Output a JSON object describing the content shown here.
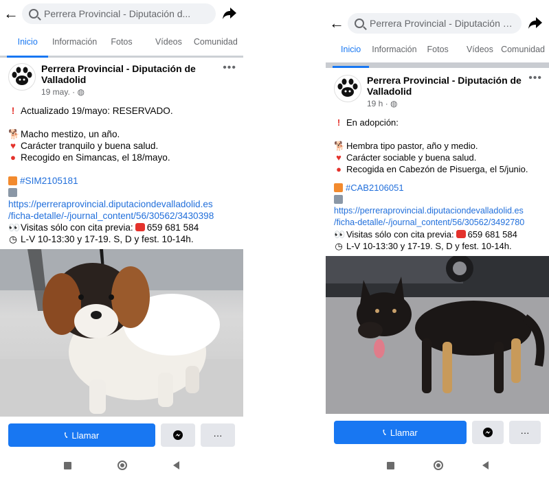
{
  "left": {
    "search_text": "Perrera Provincial - Diputación d...",
    "tabs": [
      {
        "label": "Inicio"
      },
      {
        "label": "Información"
      },
      {
        "label": "Fotos"
      },
      {
        "label": "Vídeos"
      },
      {
        "label": "Comunidad"
      }
    ],
    "post": {
      "title": "Perrera Provincial - Diputación de Valladolid",
      "time": "19 may. · ",
      "line1": "Actualizado 19/mayo: RESERVADO.",
      "line2": "Macho mestizo, un año.",
      "line3": "Carácter tranquilo y buena salud.",
      "line4": "Recogido en Simancas, el 18/mayo.",
      "hashtag": "#SIM2105181",
      "link1": "https://perreraprovincial.diputaciondevalladolid.es",
      "link2": "/ficha-detalle/-/journal_content/56/30562/3430398",
      "visits": "Visitas sólo con cita previa:",
      "phone": "659 681 584",
      "hours": "L-V 10-13:30 y 17-19. S, D y fest. 10-14h."
    },
    "call_label": "Llamar",
    "more_label": "···"
  },
  "right": {
    "search_text": "Perrera Provincial - Diputación d...",
    "tabs": [
      {
        "label": "Inicio"
      },
      {
        "label": "Información"
      },
      {
        "label": "Fotos"
      },
      {
        "label": "Vídeos"
      },
      {
        "label": "Comunidad"
      }
    ],
    "post": {
      "title": "Perrera Provincial - Diputación de Valladolid",
      "time": "19 h · ",
      "line1": "En adopción:",
      "line2": "Hembra tipo pastor, año y medio.",
      "line3": "Carácter sociable y buena salud.",
      "line4": "Recogida en Cabezón de Pisuerga, el 5/junio.",
      "hashtag": "#CAB2106051",
      "link1": "https://perreraprovincial.diputaciondevalladolid.es",
      "link2": "/ficha-detalle/-/journal_content/56/30562/3492780",
      "visits": "Visitas sólo con cita previa:",
      "phone": "659 681 584",
      "hours": "L-V 10-13:30 y 17-19. S, D y fest. 10-14h."
    },
    "call_label": "Llamar",
    "more_label": "···"
  },
  "colors": {
    "brand_blue": "#1877f2",
    "link_blue": "#216fdb",
    "alert_red": "#e4322c",
    "gray_text": "#65676b"
  },
  "icons": [
    "back-arrow-icon",
    "search-icon",
    "share-icon",
    "globe-icon",
    "more-icon",
    "exclamation-icon",
    "dog-emoji-icon",
    "heart-icon",
    "pin-icon",
    "id-badge-icon",
    "arrow-right-icon",
    "eyes-icon",
    "telephone-icon",
    "clock-icon",
    "phone-icon",
    "messenger-icon",
    "nav-square-icon",
    "nav-home-icon",
    "nav-back-icon"
  ]
}
